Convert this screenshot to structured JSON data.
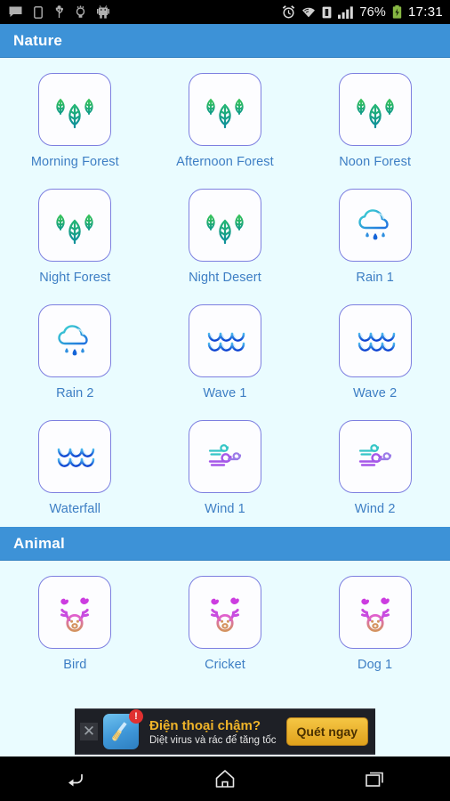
{
  "statusbar": {
    "left_icons": [
      "message-icon",
      "sim-card-icon",
      "usb-icon",
      "bulb-icon",
      "android-robot-icon"
    ],
    "right_icons": [
      "alarm-clock-icon",
      "wifi-icon",
      "sim-signal-icon",
      "cellular-signal-icon"
    ],
    "battery_percent": "76%",
    "battery_icon": "battery-charging-icon",
    "time": "17:31"
  },
  "colors": {
    "header_blue": "#3d92d7",
    "page_bg": "#eafcff",
    "card_border": "#7d7fe0",
    "label_blue": "#3d7ec4",
    "ad_accent": "#f0b429"
  },
  "sections": [
    {
      "title": "Nature",
      "items": [
        {
          "label": "Morning Forest",
          "icon": "leaves-icon"
        },
        {
          "label": "Afternoon Forest",
          "icon": "leaves-icon"
        },
        {
          "label": "Noon Forest",
          "icon": "leaves-icon"
        },
        {
          "label": "Night Forest",
          "icon": "leaves-icon"
        },
        {
          "label": "Night Desert",
          "icon": "leaves-icon"
        },
        {
          "label": "Rain 1",
          "icon": "rain-cloud-icon"
        },
        {
          "label": "Rain 2",
          "icon": "rain-cloud-icon"
        },
        {
          "label": "Wave 1",
          "icon": "waves-icon"
        },
        {
          "label": "Wave 2",
          "icon": "waves-icon"
        },
        {
          "label": "Waterfall",
          "icon": "waves-icon"
        },
        {
          "label": "Wind 1",
          "icon": "wind-swirl-icon"
        },
        {
          "label": "Wind 2",
          "icon": "wind-swirl-icon"
        }
      ]
    },
    {
      "title": "Animal",
      "items": [
        {
          "label": "Bird",
          "icon": "deer-bird-icon"
        },
        {
          "label": "Cricket",
          "icon": "deer-bird-icon"
        },
        {
          "label": "Dog 1",
          "icon": "deer-bird-icon"
        }
      ]
    }
  ],
  "ad": {
    "close_label": "✕",
    "badge": "!",
    "icon": "broom-cleaner-icon",
    "headline": "Điện thoại chậm?",
    "subline": "Diệt virus và rác để tăng tốc",
    "cta": "Quét ngay"
  },
  "navbar": {
    "buttons": [
      {
        "name": "back-button",
        "icon": "back-arrow-icon"
      },
      {
        "name": "home-button",
        "icon": "home-icon"
      },
      {
        "name": "recents-button",
        "icon": "recents-icon"
      }
    ]
  }
}
